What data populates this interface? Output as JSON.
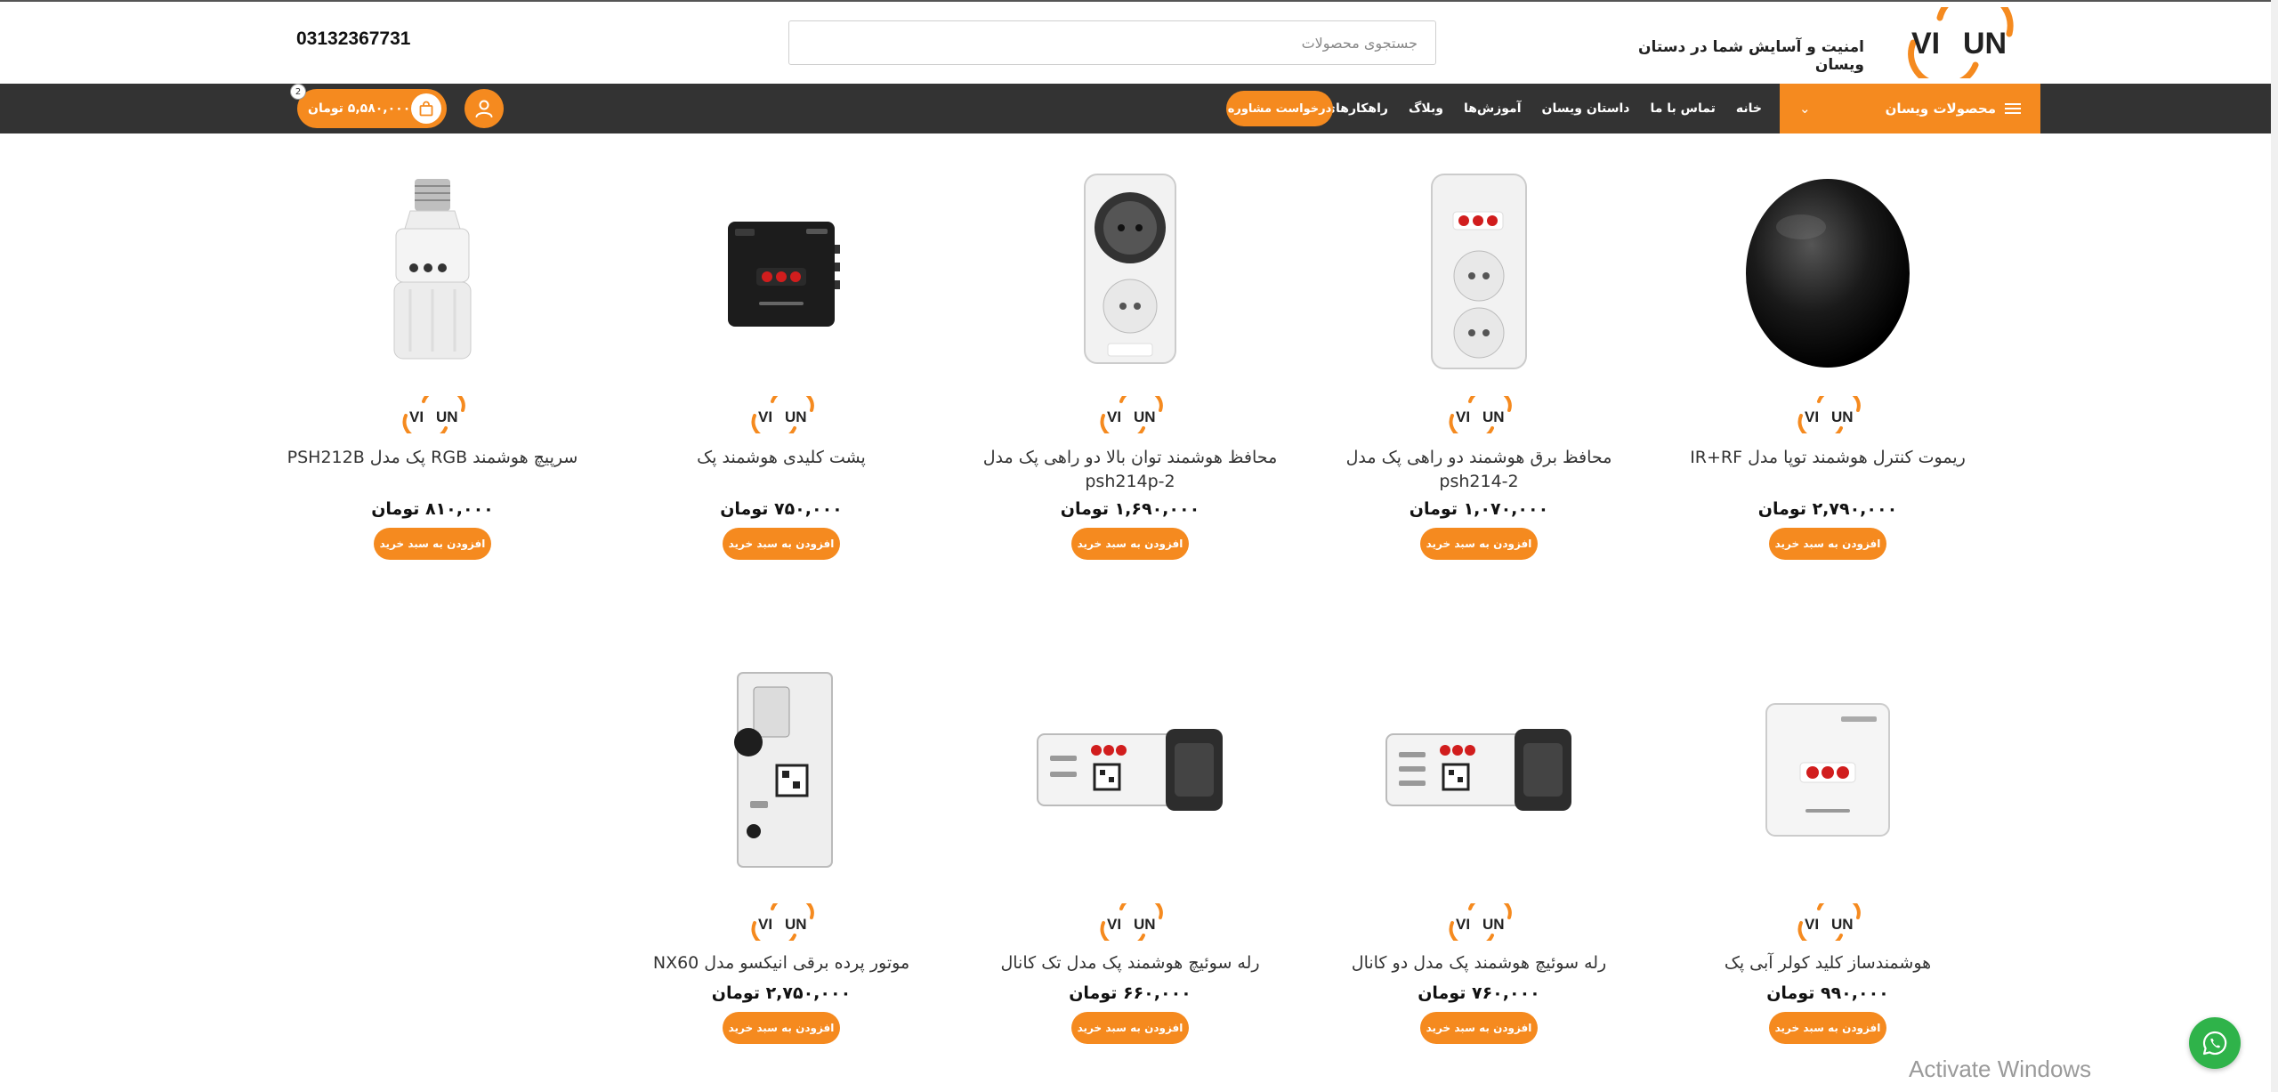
{
  "header": {
    "phone": "03132367731",
    "search_placeholder": "جستجوی محصولات",
    "tagline": "امنیت و آسایش شما در دستان ویسان",
    "logo_text_left": "VI",
    "logo_text_right": "UN"
  },
  "nav": {
    "categories_label": "محصولات ویسان",
    "items": [
      "خانه",
      "تماس با ما",
      "داستان ویسان",
      "آموزش‌ها",
      "وبلاگ",
      "راهکارهای ویسان"
    ],
    "consult_label": "درخواست مشاوره",
    "cart_amount": "۵,۵۸۰,۰۰۰ تومان",
    "cart_count": "2"
  },
  "products": {
    "row1": [
      {
        "name": "ریموت کنترل هوشمند توپا مدل IR+RF",
        "price": "۲,۷۹۰,۰۰۰ تومان",
        "button": "افزودن به سبد خرید",
        "image": "black-dome-remote"
      },
      {
        "name": "محافظ برق هوشمند دو راهی پک مدل psh214-2",
        "price": "۱,۰۷۰,۰۰۰ تومان",
        "button": "افزودن به سبد خرید",
        "image": "double-socket-protector"
      },
      {
        "name": "محافظ هوشمند توان بالا دو راهی پک مدل psh214p-2",
        "price": "۱,۶۹۰,۰۰۰ تومان",
        "button": "افزودن به سبد خرید",
        "image": "high-power-protector"
      },
      {
        "name": "پشت کلیدی هوشمند پک",
        "price": "۷۵۰,۰۰۰ تومان",
        "button": "افزودن به سبد خرید",
        "image": "black-switch-module"
      },
      {
        "name": "سرپیچ هوشمند RGB پک مدل PSH212B",
        "price": "۸۱۰,۰۰۰ تومان",
        "button": "افزودن به سبد خرید",
        "image": "bulb-socket"
      }
    ],
    "row2": [
      {
        "name": "هوشمندساز کلید کولر آبی پک",
        "price": "۹۹۰,۰۰۰ تومان",
        "button": "افزودن به سبد خرید",
        "image": "white-box-module"
      },
      {
        "name": "رله سوئیچ هوشمند پک مدل دو کانال",
        "price": "۷۶۰,۰۰۰ تومان",
        "button": "افزودن به سبد خرید",
        "image": "relay-two-channel"
      },
      {
        "name": "رله سوئیچ هوشمند پک مدل تک کانال",
        "price": "۶۶۰,۰۰۰ تومان",
        "button": "افزودن به سبد خرید",
        "image": "relay-one-channel"
      },
      {
        "name": "موتور پرده برقی انیکسو مدل NX60",
        "price": "۲,۷۵۰,۰۰۰ تومان",
        "button": "افزودن به سبد خرید",
        "image": "curtain-motor"
      }
    ]
  },
  "brand_logo": {
    "left": "VI",
    "right": "UN"
  },
  "overlay": {
    "watermark": "Activate Windows"
  },
  "colors": {
    "accent": "#f58a1f",
    "nav_bg": "#333333",
    "whatsapp": "#2fb34a"
  },
  "icons": {
    "user": "user-icon",
    "cart": "shopping-bag-icon",
    "whatsapp": "whatsapp-icon",
    "menu": "hamburger-icon",
    "chevron": "chevron-down-icon"
  }
}
